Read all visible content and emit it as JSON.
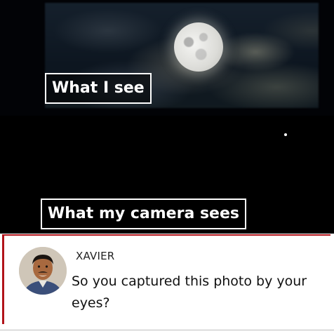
{
  "top_panel": {
    "caption": "What I see"
  },
  "bottom_panel": {
    "caption": "What my camera sees"
  },
  "comment": {
    "author": "XAVIER",
    "text": "So you captured this photo by your eyes?"
  },
  "colors": {
    "comment_border": "#b1131a",
    "caption_border": "#ffffff",
    "night_sky": "#020306"
  }
}
